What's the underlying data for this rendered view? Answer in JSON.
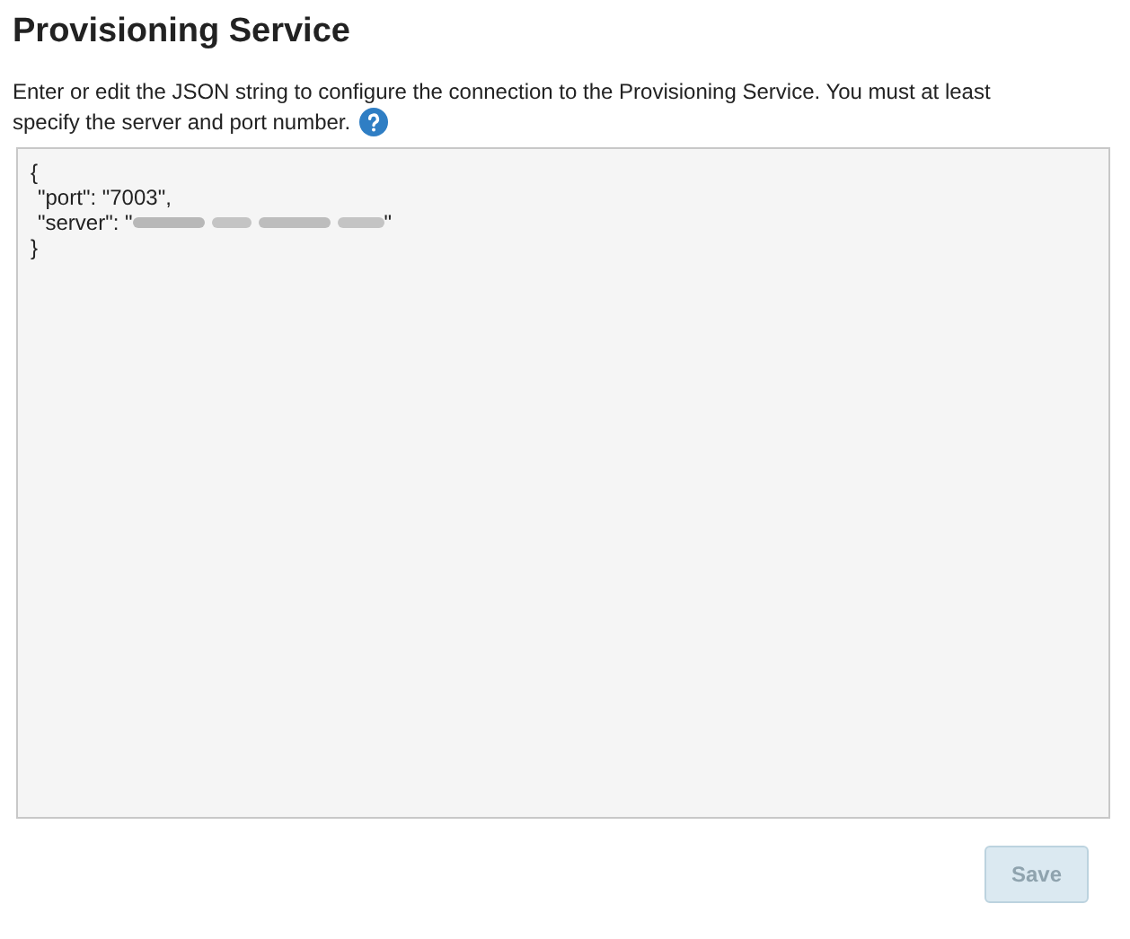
{
  "title": "Provisioning Service",
  "description_lines": [
    "Enter or edit the JSON string to configure the connection to the Provisioning Service. You must at least",
    "specify the server and port number."
  ],
  "editor": {
    "lines": [
      {
        "kind": "plain",
        "text": "{"
      },
      {
        "kind": "plain",
        "text": "\"port\": \"7003\","
      },
      {
        "kind": "redacted",
        "before": "\"server\": \"",
        "after": "\""
      },
      {
        "kind": "plain",
        "text": "}"
      }
    ]
  },
  "save_button": {
    "label": "Save",
    "disabled": true
  }
}
